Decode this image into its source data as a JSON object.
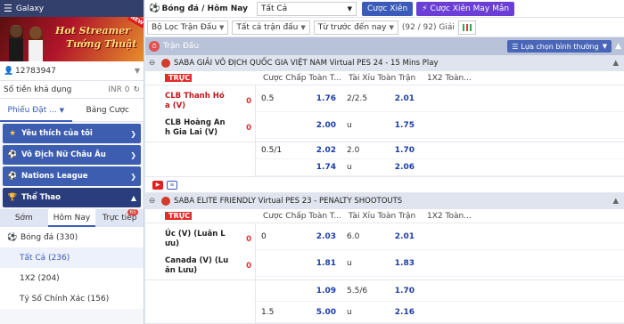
{
  "sidebar": {
    "brand": "Galaxy",
    "banner": {
      "line1": "Hot Streamer",
      "line2": "Tướng Thuật",
      "badge": "NEW"
    },
    "user": {
      "id": "12783947"
    },
    "balance": {
      "label": "Số tiền khả dụng",
      "value": "INR 0"
    },
    "tabs": [
      {
        "label": "Phiếu Đặt ..."
      },
      {
        "label": "Bảng Cược"
      }
    ],
    "menu": [
      {
        "label": "Yêu thích của tôi",
        "icon": "star-icon"
      },
      {
        "label": "Vô Địch Nữ Châu Âu",
        "icon": "soccer-ball-icon"
      },
      {
        "label": "Nations League",
        "icon": "soccer-ball-icon"
      },
      {
        "label": "Thể Thao",
        "icon": "trophy-icon"
      }
    ],
    "sport_tabs": [
      {
        "label": "Sớm"
      },
      {
        "label": "Hôm Nay"
      },
      {
        "label": "Trực tiếp"
      }
    ],
    "live_count": "65",
    "sport_list": [
      {
        "label": "Bóng đá (330)"
      },
      {
        "label": "Tất Cả (236)"
      },
      {
        "label": "1X2 (204)"
      },
      {
        "label": "Tỷ Số Chính Xác (156)"
      }
    ]
  },
  "topbar": {
    "title": "Bóng đá / Hôm Nay",
    "select_value": "Tất Cả",
    "btn_parlay": "Cược Xiên",
    "btn_lucky": "Cược Xiên May Mắn"
  },
  "filters": {
    "match_filter": "Bộ Lọc Trận Đấu",
    "all_matches": "Tất cả trận đấu",
    "time_filter": "Từ trước đến nay",
    "count": "(92 / 92) Giải"
  },
  "section": {
    "label": "Trận Đấu",
    "sort": "Lựa chọn bình thường"
  },
  "columns": {
    "live": "TRỰC",
    "hdp": "Cược Chấp Toàn T...",
    "ou": "Tài Xỉu Toàn Trận",
    "x12": "1X2 Toàn..."
  },
  "leagues": [
    {
      "name": "SABA GIẢI VÔ ĐỊCH QUỐC GIA VIỆT NAM Virtual PES 24 - 15 Mins Play",
      "matches": [
        {
          "home": "CLB Thanh Hó a (V)",
          "away": "CLB Hoàng An h Gia Lai (V)",
          "home_score": "0",
          "away_score": "0",
          "rows": [
            {
              "hc": "0.5",
              "hv": "1.76",
              "ou": "2/2.5",
              "ov": "2.01"
            },
            {
              "hc": "",
              "hv": "2.00",
              "ou": "u",
              "ov": "1.75"
            }
          ]
        },
        {
          "rows": [
            {
              "hc": "0.5/1",
              "hv": "2.02",
              "ou": "2.0",
              "ov": "1.70"
            },
            {
              "hc": "",
              "hv": "1.74",
              "ou": "u",
              "ov": "2.06"
            }
          ]
        }
      ]
    },
    {
      "name": "SABA ELITE FRIENDLY Virtual PES 23 - PENALTY SHOOTOUTS",
      "matches": [
        {
          "home": "Úc (V) (Luân L ưu)",
          "away": "Canada (V) (Lu ân Lưu)",
          "home_score": "0",
          "away_score": "0",
          "rows": [
            {
              "hc": "0",
              "hv": "2.03",
              "ou": "6.0",
              "ov": "2.01"
            },
            {
              "hc": "",
              "hv": "1.81",
              "ou": "u",
              "ov": "1.83"
            }
          ]
        },
        {
          "rows": [
            {
              "hc": "",
              "hv": "1.09",
              "ou": "5.5/6",
              "ov": "1.70"
            },
            {
              "hc": "1.5",
              "hv": "5.00",
              "ou": "u",
              "ov": "2.16"
            }
          ]
        }
      ]
    }
  ]
}
